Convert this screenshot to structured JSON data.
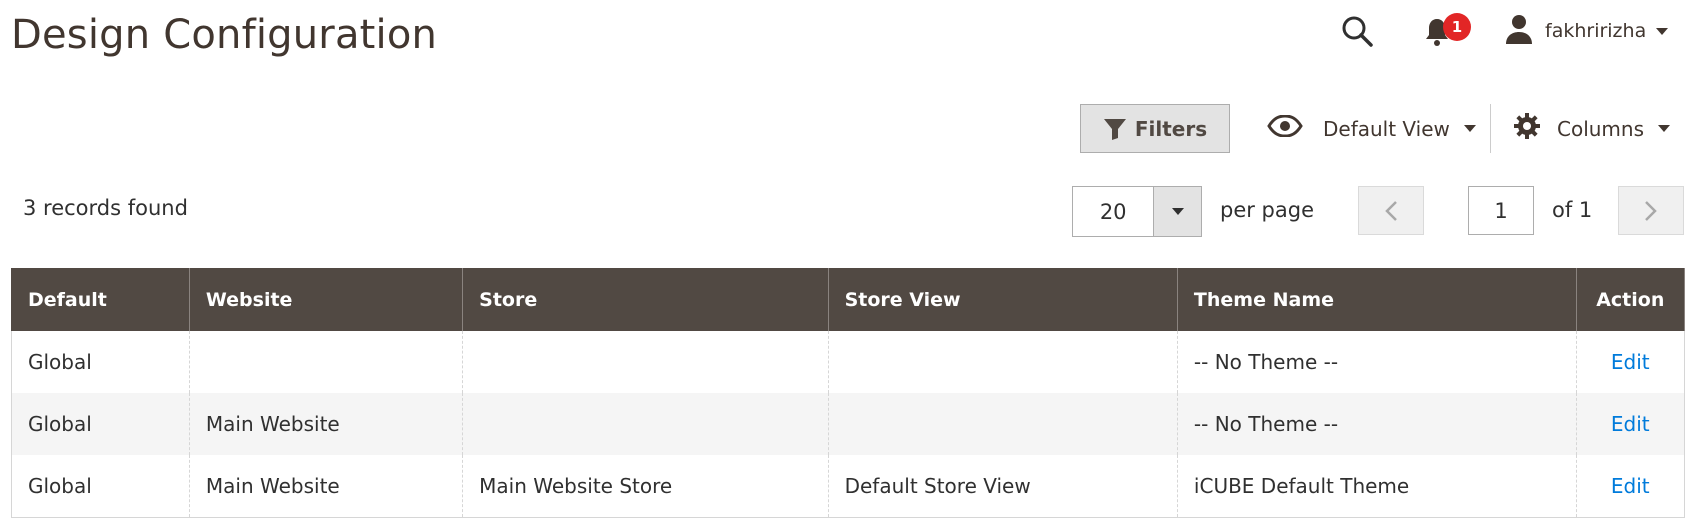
{
  "header": {
    "title": "Design Configuration",
    "notification_count": "1",
    "user_name": "fakhririzha"
  },
  "toolbar": {
    "filters_label": "Filters",
    "view_label": "Default View",
    "columns_label": "Columns"
  },
  "pagination": {
    "records_found": "3 records found",
    "per_page_value": "20",
    "per_page_label": "per page",
    "current_page": "1",
    "of_pages": "of 1"
  },
  "table": {
    "columns": [
      "Default",
      "Website",
      "Store",
      "Store View",
      "Theme Name",
      "Action"
    ],
    "rows": [
      {
        "default": "Global",
        "website": "",
        "store": "",
        "store_view": "",
        "theme": "-- No Theme --",
        "action": "Edit"
      },
      {
        "default": "Global",
        "website": "Main Website",
        "store": "",
        "store_view": "",
        "theme": "-- No Theme --",
        "action": "Edit"
      },
      {
        "default": "Global",
        "website": "Main Website",
        "store": "Main Website Store",
        "store_view": "Default Store View",
        "theme": "iCUBE Default Theme",
        "action": "Edit"
      }
    ]
  },
  "colors": {
    "header_bg": "#514943",
    "link": "#007bdb",
    "badge": "#e22626"
  }
}
